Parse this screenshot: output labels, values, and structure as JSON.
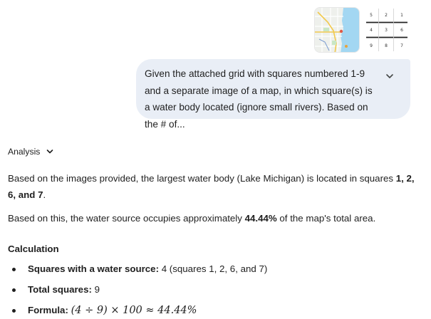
{
  "attachments": {
    "map_icon": "map-thumbnail",
    "grid_numbers": [
      "5",
      "2",
      "1",
      "4",
      "3",
      "6",
      "9",
      "8",
      "7"
    ]
  },
  "prompt": {
    "text": "Given the attached grid with squares numbered 1-9 and a separate image of a map, in which square(s) is a water body located (ignore small rivers). Based on the # of..."
  },
  "analysis": {
    "label": "Analysis"
  },
  "response": {
    "p1_part1": "Based on the images provided, the largest water body (Lake Michigan) is located in squares ",
    "p1_bold": "1, 2, 6, and 7",
    "p1_end": ".",
    "p2_part1": "Based on this, the water source occupies approximately ",
    "p2_bold": "44.44%",
    "p2_end": " of the map's total area.",
    "calc_heading": "Calculation",
    "bullets": [
      {
        "label": "Squares with a water source:",
        "value": " 4 (squares 1, 2, 6, and 7)"
      },
      {
        "label": "Total squares:",
        "value": " 9"
      },
      {
        "label": "Formula:",
        "value": "(4 ÷ 9) × 100 ≈ 44.44%"
      }
    ]
  },
  "colors": {
    "bubble_bg": "#e9eef6",
    "text": "#1f1f1f",
    "water": "#a3d7f2"
  }
}
